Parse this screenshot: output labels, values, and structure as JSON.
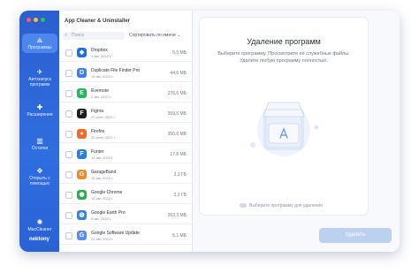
{
  "app": {
    "title": "App Cleaner & Uninstaller",
    "brand": "nektony"
  },
  "window_controls": [
    {
      "name": "close",
      "color": "#ff5f57"
    },
    {
      "name": "minimize",
      "color": "#febc2e"
    },
    {
      "name": "zoom",
      "color": "#28c840"
    }
  ],
  "sidebar": {
    "items": [
      {
        "label": "Программы",
        "icon": "apps-icon",
        "glyph": "⟁",
        "active": true
      },
      {
        "label": "Автозапуск программ",
        "icon": "rocket-icon",
        "glyph": "✈",
        "active": false
      },
      {
        "label": "Расширения",
        "icon": "puzzle-icon",
        "glyph": "✚",
        "active": false
      },
      {
        "label": "Остатки",
        "icon": "trash-icon",
        "glyph": "▥",
        "active": false
      },
      {
        "label": "Открыть с помощью",
        "icon": "open-with-icon",
        "glyph": "✥",
        "active": false
      },
      {
        "label": "MacCleaner",
        "icon": "maccleaner-icon",
        "glyph": "✺",
        "active": false
      }
    ]
  },
  "list": {
    "search_placeholder": "Поиск",
    "sort_label": "Сортировать по имени",
    "apps": [
      {
        "name": "Dropbox",
        "date": "1 авг. 2022 г.",
        "size": "5,5 МБ",
        "color": "#1f6fe8",
        "glyph": "◆"
      },
      {
        "name": "Duplicate File Finder Pro",
        "date": "13 авг. 2022 г.",
        "size": "44,6 МБ",
        "color": "#3f7df0",
        "glyph": "D"
      },
      {
        "name": "Evernote",
        "date": "2 авг. 2022 г.",
        "size": "276,6 МБ",
        "color": "#1fb85c",
        "glyph": "E"
      },
      {
        "name": "Figma",
        "date": "21 сент. 2022 г.",
        "size": "359,5 МБ",
        "color": "#1e1e1e",
        "glyph": "F"
      },
      {
        "name": "Firefox",
        "date": "22 сент. 2022 г.",
        "size": "350,6 МБ",
        "color": "#f26b2a",
        "glyph": "●"
      },
      {
        "name": "Funter",
        "date": "16 авг. 2022 г.",
        "size": "17,8 МБ",
        "color": "#2a7de1",
        "glyph": "F"
      },
      {
        "name": "GarageBand",
        "date": "15 авг. 2022 г.",
        "size": "2,3 ГБ",
        "color": "#f08a2c",
        "glyph": "G"
      },
      {
        "name": "Google Chrome",
        "date": "16 авг. 2022 г.",
        "size": "2,2 ГБ",
        "color": "#34a853",
        "glyph": "◉"
      },
      {
        "name": "Google Earth Pro",
        "date": "6 авг. 2022 г.",
        "size": "263,3 МБ",
        "color": "#3c7fde",
        "glyph": "◍"
      },
      {
        "name": "Google Software Update",
        "date": "22 авг. 2022 г.",
        "size": "5,1 МБ",
        "color": "#5a8dee",
        "glyph": "G"
      }
    ]
  },
  "main": {
    "title": "Удаление программ",
    "description": "Выберите программу. Просмотрите её служебные файлы. Удалите любую программу полностью.",
    "hint": "Выберите программу для удаления",
    "remove_button": "Удалить"
  }
}
